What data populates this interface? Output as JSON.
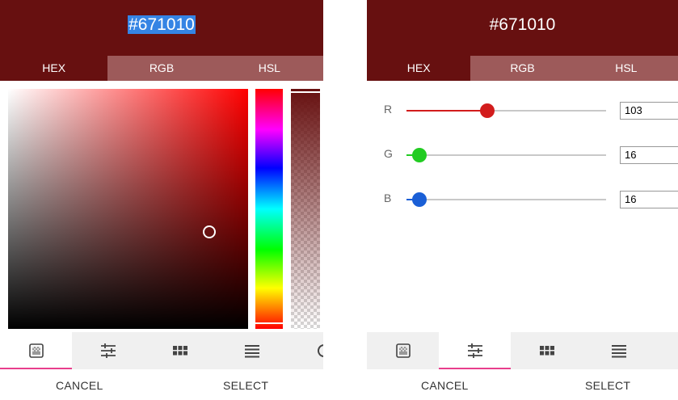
{
  "colors": {
    "header_bg": "#671010",
    "tab_inactive_bg": "#9d5a5a",
    "selection_highlight": "#3584e4",
    "active_indicator": "#e83e8c",
    "r_thumb": "#d21c1c",
    "g_thumb": "#22cc22",
    "b_thumb": "#1a5fd6"
  },
  "left_panel": {
    "hex_value": "#671010",
    "tabs": [
      {
        "label": "HEX",
        "active": true
      },
      {
        "label": "RGB",
        "active": false
      },
      {
        "label": "HSL",
        "active": false
      }
    ],
    "toolbar": [
      {
        "icon": "gradient-picker-icon",
        "active": true
      },
      {
        "icon": "sliders-icon",
        "active": false
      },
      {
        "icon": "palette-grid-icon",
        "active": false
      },
      {
        "icon": "list-icon",
        "active": false
      },
      {
        "icon": "history-icon",
        "active": false
      }
    ],
    "cancel_label": "CANCEL",
    "select_label": "SELECT"
  },
  "right_panel": {
    "hex_value": "#671010",
    "tabs": [
      {
        "label": "HEX",
        "active": true
      },
      {
        "label": "RGB",
        "active": false
      },
      {
        "label": "HSL",
        "active": false
      }
    ],
    "sliders": [
      {
        "label": "R",
        "value": "103",
        "fraction": 0.404
      },
      {
        "label": "G",
        "value": "16",
        "fraction": 0.063
      },
      {
        "label": "B",
        "value": "16",
        "fraction": 0.063
      }
    ],
    "toolbar": [
      {
        "icon": "gradient-picker-icon",
        "active": false
      },
      {
        "icon": "sliders-icon",
        "active": true
      },
      {
        "icon": "palette-grid-icon",
        "active": false
      },
      {
        "icon": "list-icon",
        "active": false
      },
      {
        "icon": "history-icon",
        "active": false
      }
    ],
    "cancel_label": "CANCEL",
    "select_label": "SELECT"
  }
}
